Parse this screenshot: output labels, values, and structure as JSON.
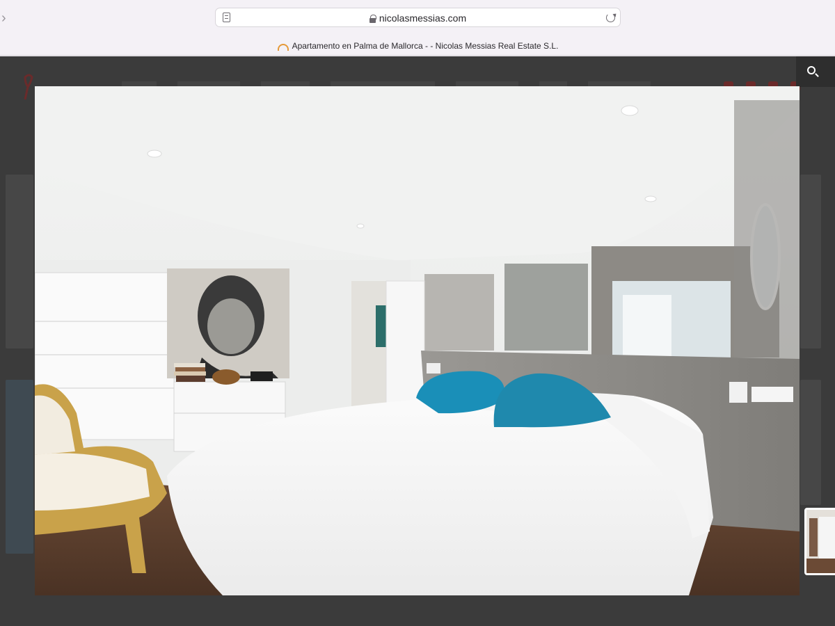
{
  "browser": {
    "url": "nicolasmessias.com",
    "tab_title": "Apartamento en Palma de Mallorca - - Nicolas Messias Real Estate S.L.",
    "icons": [
      "reader-icon",
      "lock-icon",
      "reload-icon",
      "chevron-right-icon"
    ]
  },
  "lightbox": {
    "image_subject": "bedroom",
    "thumbnail_active": true
  },
  "colors": {
    "overlay": "#3b3b3b",
    "pillow": "#1a8fb8",
    "frame": "#c9a24a"
  }
}
